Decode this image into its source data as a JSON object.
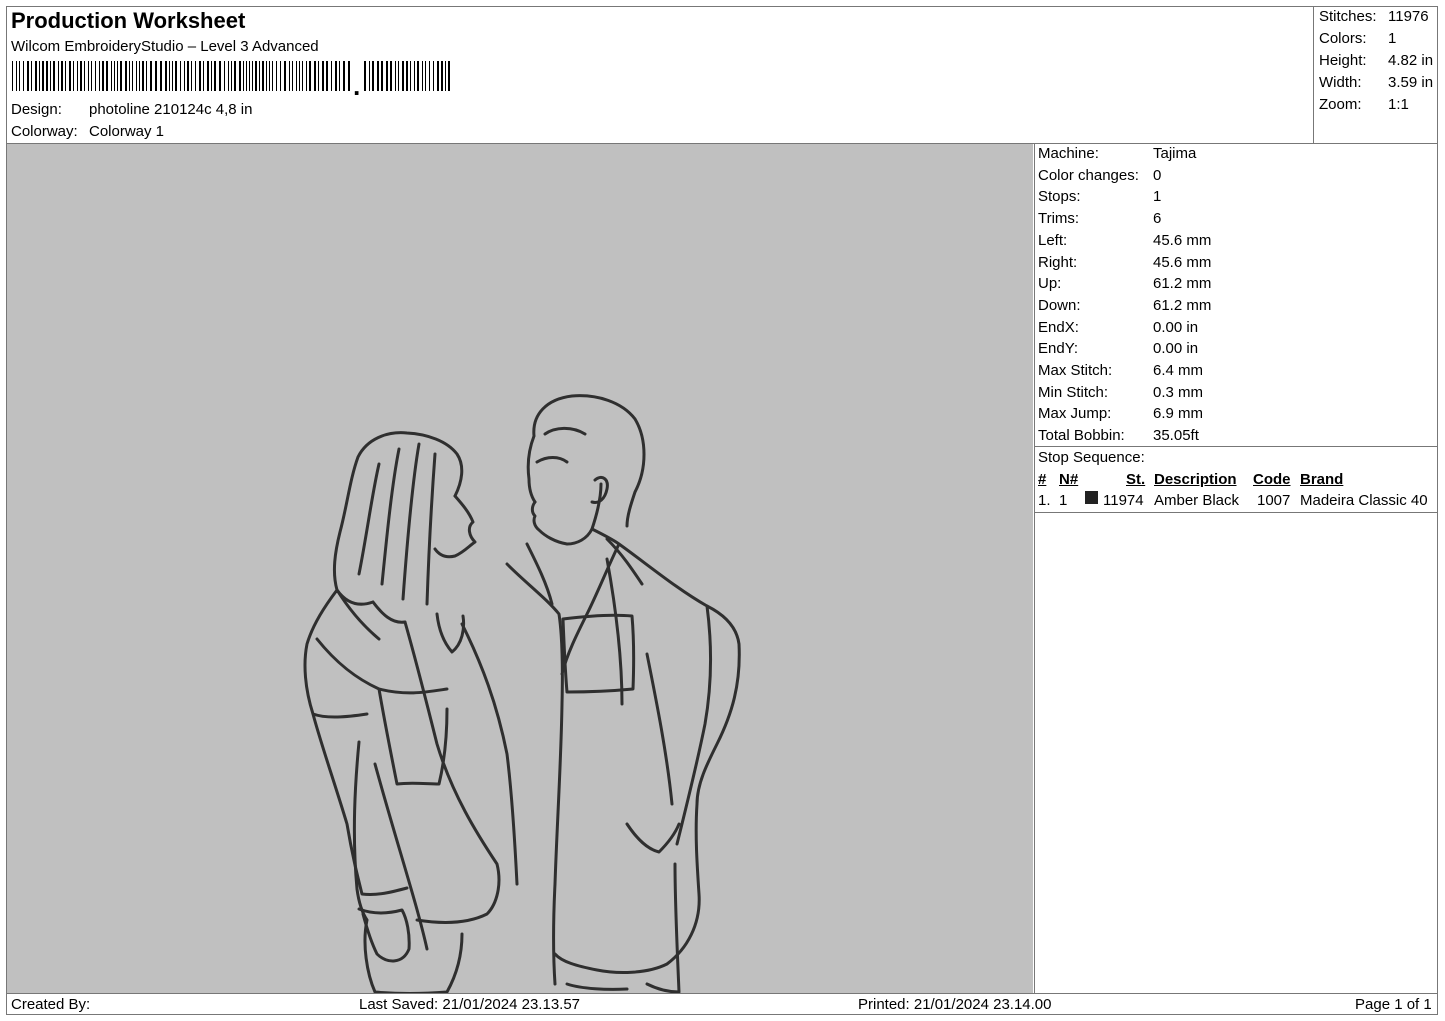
{
  "header": {
    "title": "Production Worksheet",
    "software": "Wilcom EmbroideryStudio – Level 3 Advanced",
    "design_label": "Design:",
    "design_value": "photoline 210124c 4,8 in",
    "colorway_label": "Colorway:",
    "colorway_value": "Colorway 1"
  },
  "summary": [
    {
      "label": "Stitches:",
      "value": "11976"
    },
    {
      "label": "Colors:",
      "value": "1"
    },
    {
      "label": "Height:",
      "value": "4.82 in"
    },
    {
      "label": "Width:",
      "value": "3.59 in"
    },
    {
      "label": "Zoom:",
      "value": "1:1"
    }
  ],
  "machine_info": [
    {
      "label": "Machine:",
      "value": "Tajima"
    },
    {
      "label": "Color changes:",
      "value": "0"
    },
    {
      "label": "Stops:",
      "value": "1"
    },
    {
      "label": "Trims:",
      "value": "6"
    },
    {
      "label": "Left:",
      "value": "45.6 mm"
    },
    {
      "label": "Right:",
      "value": "45.6 mm"
    },
    {
      "label": "Up:",
      "value": "61.2 mm"
    },
    {
      "label": "Down:",
      "value": "61.2 mm"
    },
    {
      "label": "EndX:",
      "value": "0.00 in"
    },
    {
      "label": "EndY:",
      "value": "0.00 in"
    },
    {
      "label": "Max Stitch:",
      "value": "6.4 mm"
    },
    {
      "label": "Min Stitch:",
      "value": "0.3 mm"
    },
    {
      "label": "Max Jump:",
      "value": "6.9 mm"
    },
    {
      "label": "Total Bobbin:",
      "value": "35.05ft"
    }
  ],
  "stop_sequence": {
    "title": "Stop Sequence:",
    "headers": {
      "num": "#",
      "n": "N#",
      "st": "St.",
      "description": "Description",
      "code": "Code",
      "brand": "Brand"
    },
    "rows": [
      {
        "num": "1.",
        "n": "1",
        "swatch_color": "#222222",
        "st": "11974",
        "description": "Amber Black",
        "code": "1007",
        "brand": "Madeira Classic 40"
      }
    ]
  },
  "footer": {
    "created_by": "Created By:",
    "last_saved": "Last Saved: 21/01/2024 23.13.57",
    "printed": "Printed: 21/01/2024 23.14.00",
    "page": "Page 1 of 1"
  },
  "colors": {
    "canvas_bg": "#c0c0c0",
    "thread": "#2f2f2f"
  }
}
